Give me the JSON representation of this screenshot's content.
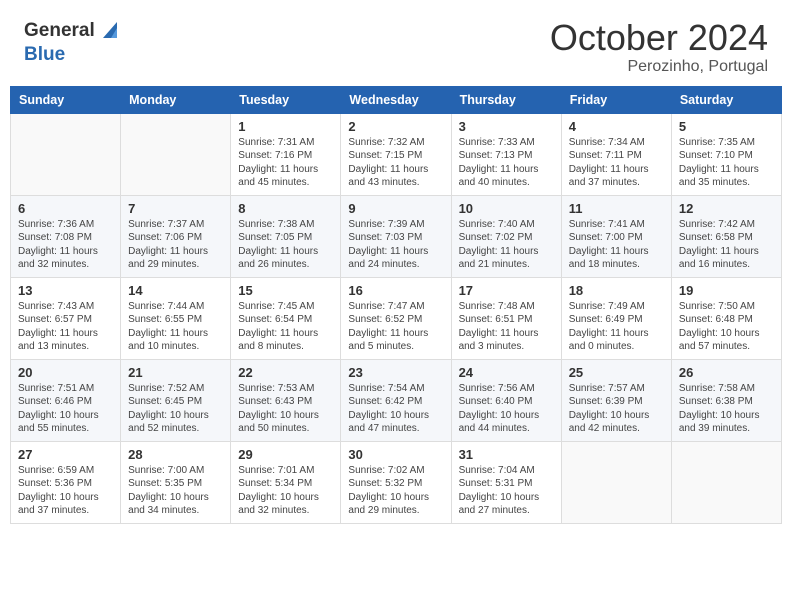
{
  "header": {
    "logo_line1": "General",
    "logo_line2": "Blue",
    "month": "October 2024",
    "location": "Perozinho, Portugal"
  },
  "days_of_week": [
    "Sunday",
    "Monday",
    "Tuesday",
    "Wednesday",
    "Thursday",
    "Friday",
    "Saturday"
  ],
  "weeks": [
    [
      {
        "day": "",
        "info": ""
      },
      {
        "day": "",
        "info": ""
      },
      {
        "day": "1",
        "info": "Sunrise: 7:31 AM\nSunset: 7:16 PM\nDaylight: 11 hours and 45 minutes."
      },
      {
        "day": "2",
        "info": "Sunrise: 7:32 AM\nSunset: 7:15 PM\nDaylight: 11 hours and 43 minutes."
      },
      {
        "day": "3",
        "info": "Sunrise: 7:33 AM\nSunset: 7:13 PM\nDaylight: 11 hours and 40 minutes."
      },
      {
        "day": "4",
        "info": "Sunrise: 7:34 AM\nSunset: 7:11 PM\nDaylight: 11 hours and 37 minutes."
      },
      {
        "day": "5",
        "info": "Sunrise: 7:35 AM\nSunset: 7:10 PM\nDaylight: 11 hours and 35 minutes."
      }
    ],
    [
      {
        "day": "6",
        "info": "Sunrise: 7:36 AM\nSunset: 7:08 PM\nDaylight: 11 hours and 32 minutes."
      },
      {
        "day": "7",
        "info": "Sunrise: 7:37 AM\nSunset: 7:06 PM\nDaylight: 11 hours and 29 minutes."
      },
      {
        "day": "8",
        "info": "Sunrise: 7:38 AM\nSunset: 7:05 PM\nDaylight: 11 hours and 26 minutes."
      },
      {
        "day": "9",
        "info": "Sunrise: 7:39 AM\nSunset: 7:03 PM\nDaylight: 11 hours and 24 minutes."
      },
      {
        "day": "10",
        "info": "Sunrise: 7:40 AM\nSunset: 7:02 PM\nDaylight: 11 hours and 21 minutes."
      },
      {
        "day": "11",
        "info": "Sunrise: 7:41 AM\nSunset: 7:00 PM\nDaylight: 11 hours and 18 minutes."
      },
      {
        "day": "12",
        "info": "Sunrise: 7:42 AM\nSunset: 6:58 PM\nDaylight: 11 hours and 16 minutes."
      }
    ],
    [
      {
        "day": "13",
        "info": "Sunrise: 7:43 AM\nSunset: 6:57 PM\nDaylight: 11 hours and 13 minutes."
      },
      {
        "day": "14",
        "info": "Sunrise: 7:44 AM\nSunset: 6:55 PM\nDaylight: 11 hours and 10 minutes."
      },
      {
        "day": "15",
        "info": "Sunrise: 7:45 AM\nSunset: 6:54 PM\nDaylight: 11 hours and 8 minutes."
      },
      {
        "day": "16",
        "info": "Sunrise: 7:47 AM\nSunset: 6:52 PM\nDaylight: 11 hours and 5 minutes."
      },
      {
        "day": "17",
        "info": "Sunrise: 7:48 AM\nSunset: 6:51 PM\nDaylight: 11 hours and 3 minutes."
      },
      {
        "day": "18",
        "info": "Sunrise: 7:49 AM\nSunset: 6:49 PM\nDaylight: 11 hours and 0 minutes."
      },
      {
        "day": "19",
        "info": "Sunrise: 7:50 AM\nSunset: 6:48 PM\nDaylight: 10 hours and 57 minutes."
      }
    ],
    [
      {
        "day": "20",
        "info": "Sunrise: 7:51 AM\nSunset: 6:46 PM\nDaylight: 10 hours and 55 minutes."
      },
      {
        "day": "21",
        "info": "Sunrise: 7:52 AM\nSunset: 6:45 PM\nDaylight: 10 hours and 52 minutes."
      },
      {
        "day": "22",
        "info": "Sunrise: 7:53 AM\nSunset: 6:43 PM\nDaylight: 10 hours and 50 minutes."
      },
      {
        "day": "23",
        "info": "Sunrise: 7:54 AM\nSunset: 6:42 PM\nDaylight: 10 hours and 47 minutes."
      },
      {
        "day": "24",
        "info": "Sunrise: 7:56 AM\nSunset: 6:40 PM\nDaylight: 10 hours and 44 minutes."
      },
      {
        "day": "25",
        "info": "Sunrise: 7:57 AM\nSunset: 6:39 PM\nDaylight: 10 hours and 42 minutes."
      },
      {
        "day": "26",
        "info": "Sunrise: 7:58 AM\nSunset: 6:38 PM\nDaylight: 10 hours and 39 minutes."
      }
    ],
    [
      {
        "day": "27",
        "info": "Sunrise: 6:59 AM\nSunset: 5:36 PM\nDaylight: 10 hours and 37 minutes."
      },
      {
        "day": "28",
        "info": "Sunrise: 7:00 AM\nSunset: 5:35 PM\nDaylight: 10 hours and 34 minutes."
      },
      {
        "day": "29",
        "info": "Sunrise: 7:01 AM\nSunset: 5:34 PM\nDaylight: 10 hours and 32 minutes."
      },
      {
        "day": "30",
        "info": "Sunrise: 7:02 AM\nSunset: 5:32 PM\nDaylight: 10 hours and 29 minutes."
      },
      {
        "day": "31",
        "info": "Sunrise: 7:04 AM\nSunset: 5:31 PM\nDaylight: 10 hours and 27 minutes."
      },
      {
        "day": "",
        "info": ""
      },
      {
        "day": "",
        "info": ""
      }
    ]
  ]
}
